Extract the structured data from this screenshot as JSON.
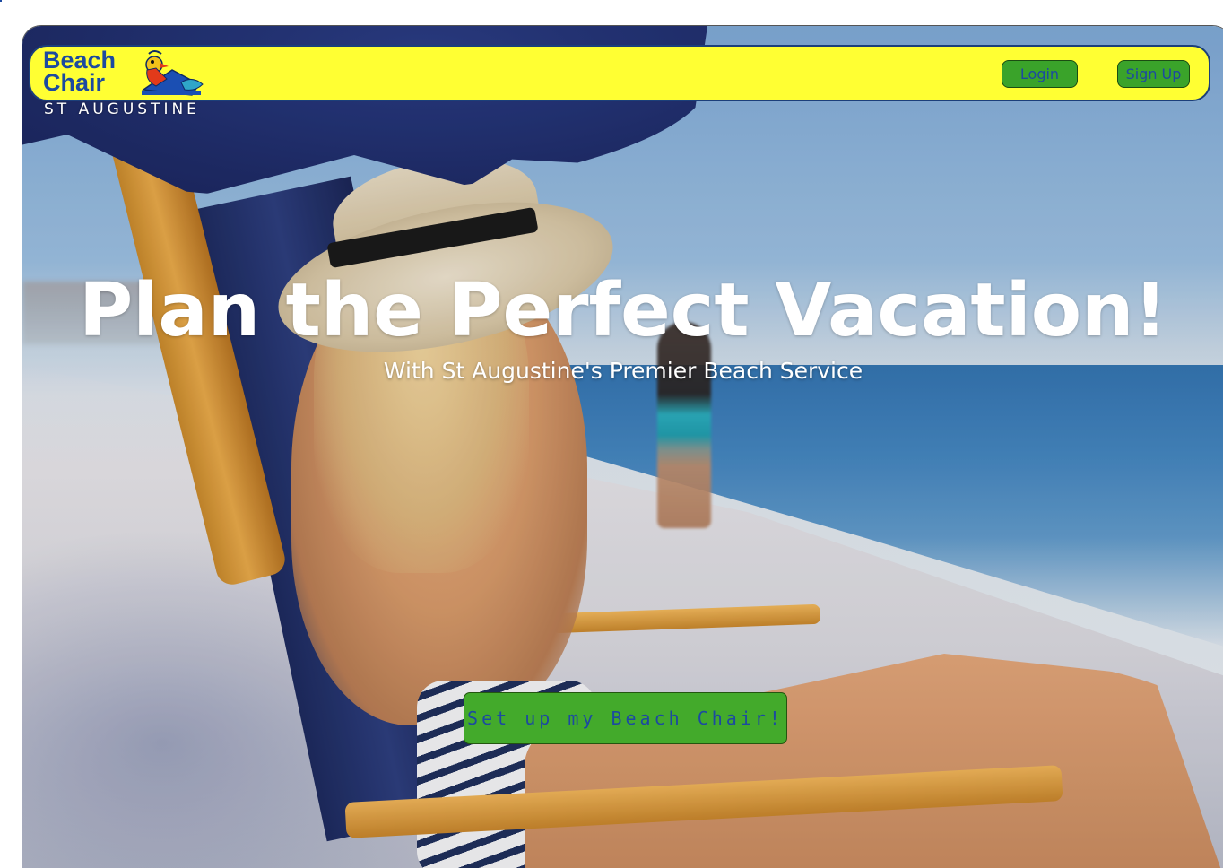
{
  "brand": {
    "logo_line1": "Beach",
    "logo_line2": "Chair",
    "location": "ST AUGUSTINE",
    "mascot_icon": "parrot-in-beach-chair-icon"
  },
  "nav": {
    "login_label": "Login",
    "signup_label": "Sign Up"
  },
  "hero": {
    "title": "Plan the Perfect Vacation!",
    "subtitle": "With St Augustine's Premier Beach Service",
    "cta_label": "Set up my Beach Chair!",
    "background_image": "woman-in-sunhat-on-beach-chair"
  },
  "colors": {
    "header_bg": "#ffff33",
    "brand_blue": "#1c4aa0",
    "button_green": "#3aa32a",
    "hero_text": "#ffffff"
  }
}
